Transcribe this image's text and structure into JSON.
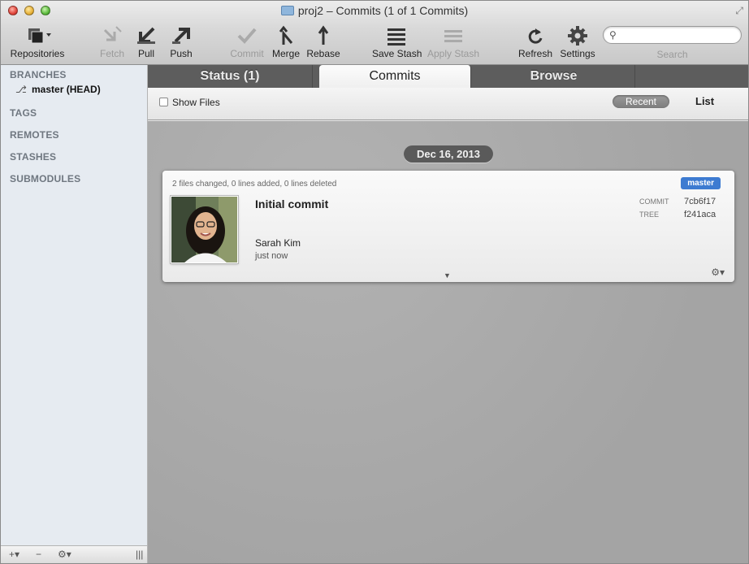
{
  "window": {
    "title": "proj2 – Commits (1 of 1 Commits)"
  },
  "toolbar": {
    "repositories": "Repositories",
    "fetch": "Fetch",
    "pull": "Pull",
    "push": "Push",
    "commit": "Commit",
    "merge": "Merge",
    "rebase": "Rebase",
    "save_stash": "Save Stash",
    "apply_stash": "Apply Stash",
    "refresh": "Refresh",
    "settings": "Settings",
    "search_label": "Search",
    "search_value": ""
  },
  "sidebar": {
    "branches_header": "BRANCHES",
    "current_branch": "master (HEAD)",
    "tags_header": "TAGS",
    "remotes_header": "REMOTES",
    "stashes_header": "STASHES",
    "submodules_header": "SUBMODULES",
    "footer": {
      "add": "+▾",
      "remove": "−",
      "gear": "⚙▾",
      "resize": "|||"
    }
  },
  "tabs": {
    "status": "Status (1)",
    "commits": "Commits",
    "browse": "Browse"
  },
  "subbar": {
    "show_files": "Show Files",
    "show_files_checked": false,
    "recent": "Recent",
    "list": "List"
  },
  "commits": {
    "date": "Dec 16, 2013",
    "stats": "2 files changed, 0 lines added, 0 lines deleted",
    "branch_badge": "master",
    "message": "Initial commit",
    "author": "Sarah Kim",
    "time": "just now",
    "commit_label": "COMMIT",
    "commit_hash": "7cb6f17",
    "tree_label": "TREE",
    "tree_hash": "f241aca"
  },
  "colors": {
    "badge": "#3d7bd1",
    "tab_bar": "#5d5d5d",
    "content_bg": "#a9a9a9"
  }
}
